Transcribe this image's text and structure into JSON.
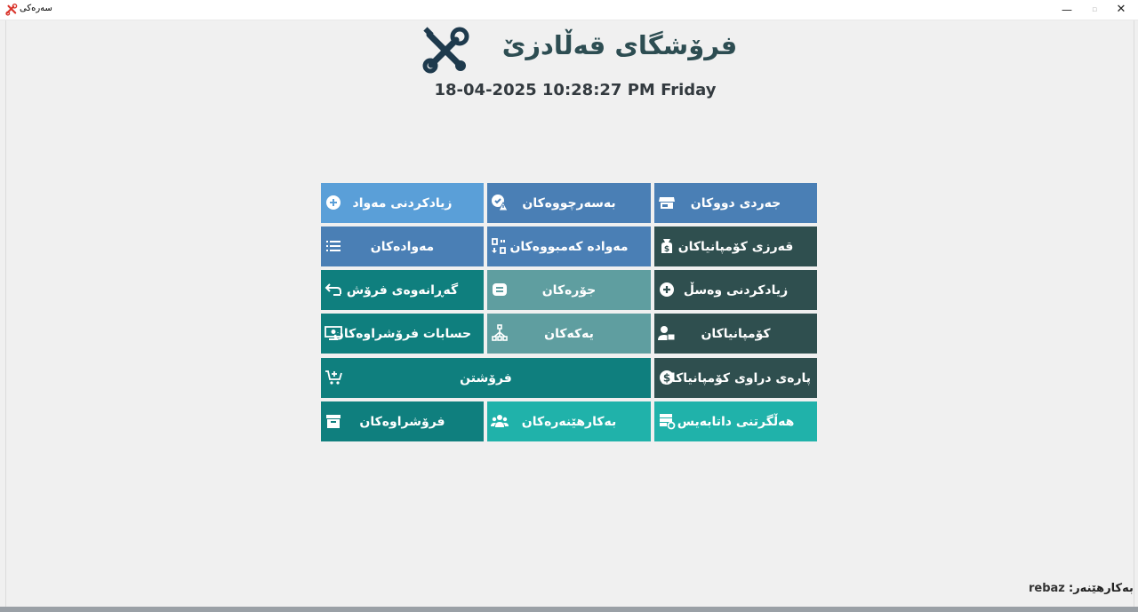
{
  "window": {
    "title": "سەرەکی",
    "controls": {
      "minimize": "—",
      "maximize": "▫",
      "close": "✕"
    }
  },
  "header": {
    "logo_icon": "tools-icon",
    "shop_name": "فرۆشگای قەڵادزێ",
    "datetime": "18-04-2025 10:28:27 PM Friday"
  },
  "colors": {
    "blue_light": "#5a9fd8",
    "blue": "#4a7fb5",
    "dark_slate": "#2f4f4f",
    "teal_dark": "#0f7f7e",
    "teal_grey": "#5f9ea0",
    "teal_light": "#20b2aa"
  },
  "menu": {
    "add_items": {
      "label": "زیادکردنی مەواد",
      "icon": "plus-circle-icon"
    },
    "expired": {
      "label": "بەسەرچووەکان",
      "icon": "expired-warning-icon"
    },
    "shop_inventory": {
      "label": "جەردی دووکان",
      "icon": "store-icon"
    },
    "items": {
      "label": "مەوادەکان",
      "icon": "list-icon"
    },
    "low_stock": {
      "label": "مەوادە کەمبووەکان",
      "icon": "low-stock-icon"
    },
    "company_debts": {
      "label": "قەرزی کۆمپانیاکان",
      "icon": "money-bag-icon"
    },
    "returns": {
      "label": "گەڕانەوەی فرۆش",
      "icon": "return-arrow-icon"
    },
    "categories": {
      "label": "جۆرەکان",
      "icon": "category-icon"
    },
    "add_receipt": {
      "label": "زیادکردنی وەسڵ",
      "icon": "plus-circle-icon"
    },
    "sales_accounts": {
      "label": "حسابات فرۆشراوەکان",
      "icon": "cash-register-icon"
    },
    "units": {
      "label": "یەکەکان",
      "icon": "hierarchy-icon"
    },
    "companies": {
      "label": "کۆمپانیاکان",
      "icon": "company-user-icon"
    },
    "selling": {
      "label": "فرۆشتن",
      "icon": "cart-add-icon"
    },
    "company_payments": {
      "label": "پارەی دراوی کۆمپانیاکان",
      "icon": "dollar-circle-icon"
    },
    "sold_items": {
      "label": "فرۆشراوەکان",
      "icon": "archive-box-icon"
    },
    "users": {
      "label": "بەکارهێنەرەکان",
      "icon": "users-icon"
    },
    "backup_db": {
      "label": "هەڵگرتنی داتابەیس",
      "icon": "database-backup-icon"
    }
  },
  "footer": {
    "user_label": "بەکارهێنەر:",
    "username": "rebaz"
  }
}
